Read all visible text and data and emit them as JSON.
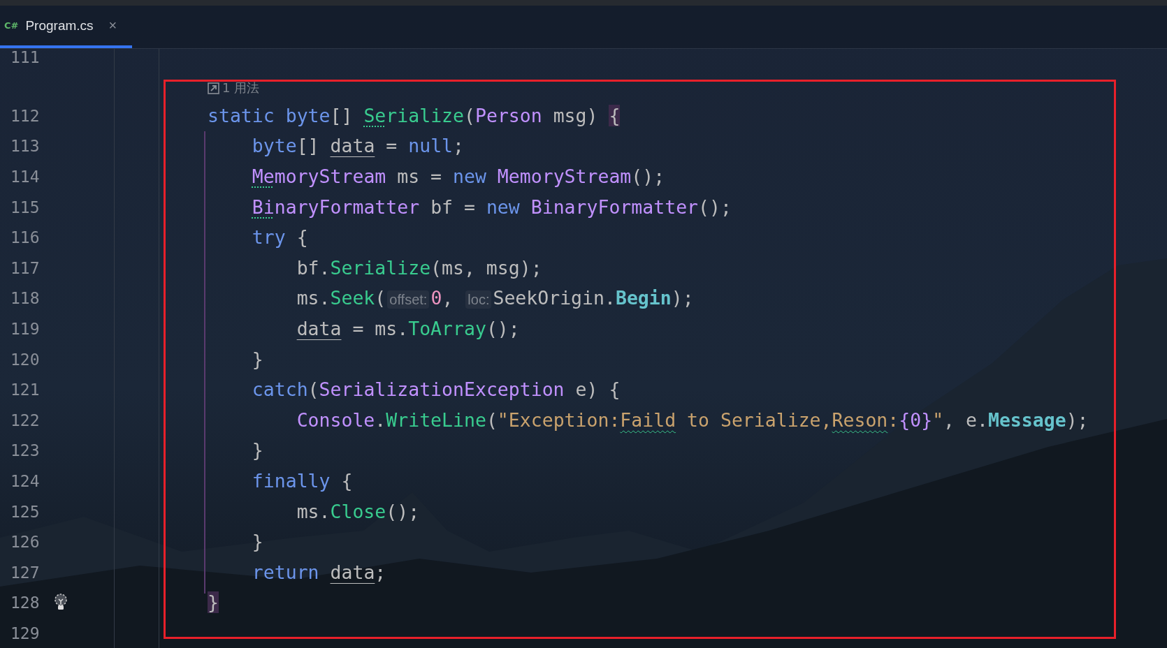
{
  "tabs": [
    {
      "icon_text": "C#",
      "label": "Program.cs",
      "close": "×",
      "selected": true
    }
  ],
  "lines": [
    {
      "number": "111"
    },
    {
      "kind": "usages",
      "text": "1 用法"
    },
    {
      "number": "112",
      "tokens": [
        {
          "kind": "kw",
          "text": "static "
        },
        {
          "kind": "kw",
          "text": "byte"
        },
        {
          "kind": "plain",
          "text": "[] "
        },
        {
          "kind": "method",
          "text": "Se",
          "dotted_underline": true
        },
        {
          "kind": "method",
          "text": "rialize"
        },
        {
          "kind": "plain",
          "text": "("
        },
        {
          "kind": "type",
          "text": "Person"
        },
        {
          "kind": "plain",
          "text": " msg) "
        },
        {
          "kind": "brace",
          "text": "{"
        }
      ]
    },
    {
      "number": "113",
      "tokens": [
        {
          "kind": "kw",
          "text": "    byte"
        },
        {
          "kind": "plain",
          "text": "[] "
        },
        {
          "kind": "plain",
          "text": "data",
          "underlined": true
        },
        {
          "kind": "plain",
          "text": " = "
        },
        {
          "kind": "kw",
          "text": "null"
        },
        {
          "kind": "plain",
          "text": ";"
        }
      ]
    },
    {
      "number": "114",
      "tokens": [
        {
          "kind": "type",
          "text": "    Me",
          "dotted_underline": true
        },
        {
          "kind": "type",
          "text": "moryStream"
        },
        {
          "kind": "plain",
          "text": " ms = "
        },
        {
          "kind": "kw",
          "text": "new "
        },
        {
          "kind": "type",
          "text": "MemoryStream"
        },
        {
          "kind": "plain",
          "text": "();"
        }
      ]
    },
    {
      "number": "115",
      "tokens": [
        {
          "kind": "type",
          "text": "    Bi",
          "dotted_underline": true
        },
        {
          "kind": "type",
          "text": "naryFormatter"
        },
        {
          "kind": "plain",
          "text": " bf = "
        },
        {
          "kind": "kw",
          "text": "new "
        },
        {
          "kind": "type",
          "text": "BinaryFormatter"
        },
        {
          "kind": "plain",
          "text": "();"
        }
      ]
    },
    {
      "number": "116",
      "tokens": [
        {
          "kind": "kw",
          "text": "    try"
        },
        {
          "kind": "plain",
          "text": " {"
        }
      ]
    },
    {
      "number": "117",
      "tokens": [
        {
          "kind": "plain",
          "text": "        bf."
        },
        {
          "kind": "method",
          "text": "Serialize"
        },
        {
          "kind": "plain",
          "text": "(ms, msg);"
        }
      ]
    },
    {
      "number": "118",
      "tokens": [
        {
          "kind": "plain",
          "text": "        ms."
        },
        {
          "kind": "method",
          "text": "Seek"
        },
        {
          "kind": "plain",
          "text": "("
        },
        {
          "kind": "hint",
          "text": "offset:"
        },
        {
          "kind": "number",
          "text": "0"
        },
        {
          "kind": "plain",
          "text": ", "
        },
        {
          "kind": "hint",
          "text": "loc:"
        },
        {
          "kind": "plain",
          "text": "SeekOrigin."
        },
        {
          "kind": "prop",
          "text": "Begin"
        },
        {
          "kind": "plain",
          "text": ");"
        }
      ]
    },
    {
      "number": "119",
      "tokens": [
        {
          "kind": "plain",
          "text": "        data",
          "underlined": true
        },
        {
          "kind": "plain",
          "text": " = ms."
        },
        {
          "kind": "method",
          "text": "ToArray"
        },
        {
          "kind": "plain",
          "text": "();"
        }
      ]
    },
    {
      "number": "120",
      "tokens": [
        {
          "kind": "plain",
          "text": "    }"
        }
      ]
    },
    {
      "number": "121",
      "tokens": [
        {
          "kind": "kw",
          "text": "    catch"
        },
        {
          "kind": "plain",
          "text": "("
        },
        {
          "kind": "type",
          "text": "SerializationException"
        },
        {
          "kind": "plain",
          "text": " e) {"
        }
      ]
    },
    {
      "number": "122",
      "tokens": [
        {
          "kind": "type",
          "text": "        Console"
        },
        {
          "kind": "plain",
          "text": "."
        },
        {
          "kind": "method",
          "text": "WriteLine"
        },
        {
          "kind": "plain",
          "text": "("
        },
        {
          "kind": "string",
          "text": "\"Exception:"
        },
        {
          "kind": "string",
          "text": "Faild",
          "wavy_underline": true
        },
        {
          "kind": "string",
          "text": " to Serialize,"
        },
        {
          "kind": "string",
          "text": "Reson",
          "wavy_underline": true
        },
        {
          "kind": "string",
          "text": ":"
        },
        {
          "kind": "type",
          "text": "{0}"
        },
        {
          "kind": "string",
          "text": "\""
        },
        {
          "kind": "plain",
          "text": ", e."
        },
        {
          "kind": "prop",
          "text": "Message"
        },
        {
          "kind": "plain",
          "text": ");"
        }
      ]
    },
    {
      "number": "123",
      "tokens": [
        {
          "kind": "plain",
          "text": "    }"
        }
      ]
    },
    {
      "number": "124",
      "tokens": [
        {
          "kind": "kw",
          "text": "    finally"
        },
        {
          "kind": "plain",
          "text": " {"
        }
      ]
    },
    {
      "number": "125",
      "tokens": [
        {
          "kind": "plain",
          "text": "        ms."
        },
        {
          "kind": "method",
          "text": "Close"
        },
        {
          "kind": "plain",
          "text": "();"
        }
      ]
    },
    {
      "number": "126",
      "tokens": [
        {
          "kind": "plain",
          "text": "    }"
        }
      ]
    },
    {
      "number": "127",
      "tokens": [
        {
          "kind": "kw",
          "text": "    return"
        },
        {
          "kind": "plain",
          "text": " data",
          "underlined": true
        },
        {
          "kind": "plain",
          "text": ";"
        }
      ]
    },
    {
      "number": "128",
      "lightbulb": true,
      "tokens": [
        {
          "kind": "brace",
          "text": "}"
        }
      ]
    },
    {
      "number": "129"
    }
  ]
}
